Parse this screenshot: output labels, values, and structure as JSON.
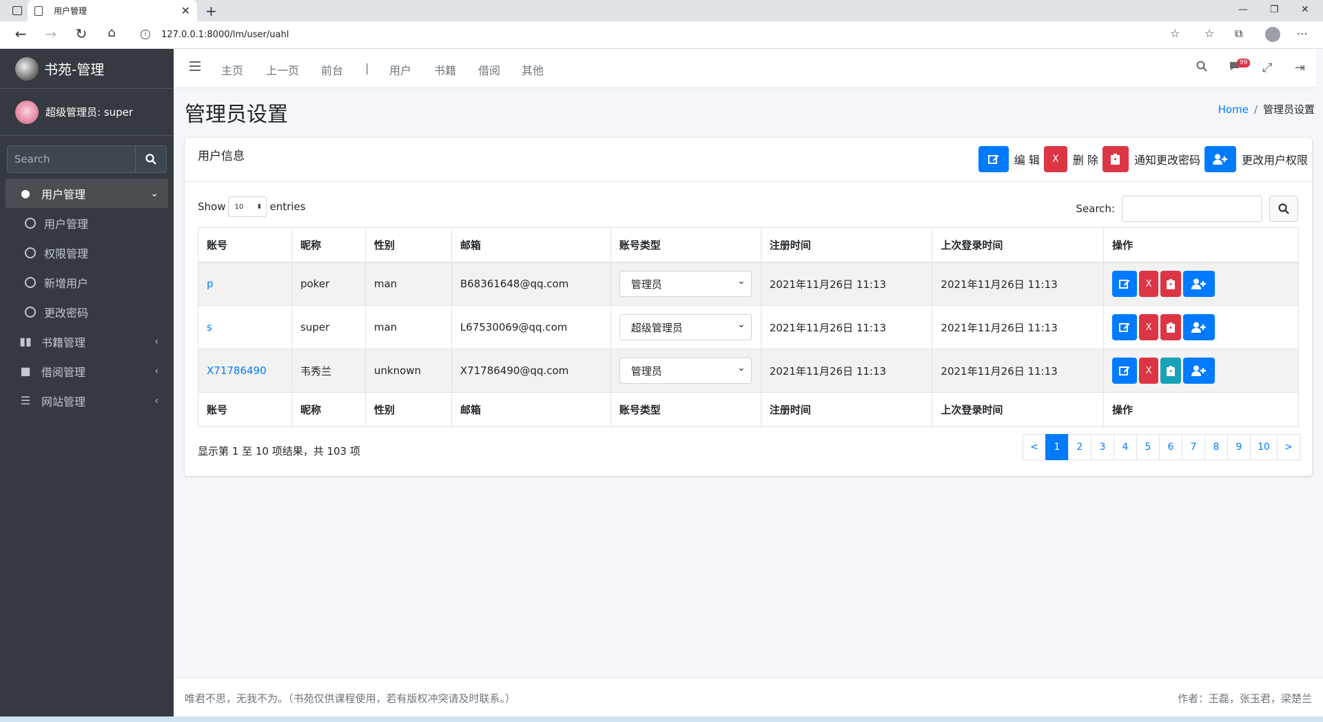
{
  "browser": {
    "tab_title": "用户管理",
    "tab_close": "✕",
    "new_tab": "+",
    "url": "127.0.0.1:8000/lm/user/uahl",
    "controls": {
      "minimize": "—",
      "restore": "❐",
      "close": "✕"
    }
  },
  "sidebar": {
    "brand": "书苑-管理",
    "user": "超级管理员: super",
    "search_placeholder": "Search",
    "items": [
      {
        "label": "用户管理",
        "icon": "user-icon",
        "active": true
      },
      {
        "label": "用户管理",
        "sub": true
      },
      {
        "label": "权限管理",
        "sub": true
      },
      {
        "label": "新增用户",
        "sub": true
      },
      {
        "label": "更改密码",
        "sub": true
      },
      {
        "label": "书籍管理",
        "icon": "book-icon"
      },
      {
        "label": "借阅管理",
        "icon": "box-icon"
      },
      {
        "label": "网站管理",
        "icon": "list-icon"
      }
    ]
  },
  "topnav": {
    "links": [
      "主页",
      "上一页",
      "前台",
      "|",
      "用户",
      "书籍",
      "借阅",
      "其他"
    ],
    "badge": "99"
  },
  "page": {
    "title": "管理员设置",
    "breadcrumb": {
      "home": "Home",
      "sep": "/",
      "current": "管理员设置"
    }
  },
  "card": {
    "title": "用户信息",
    "actions": [
      {
        "label": "编 辑",
        "color": "#007bff",
        "icon": "edit-icon"
      },
      {
        "label": "删 除",
        "color": "#dc3545",
        "icon": "x-icon",
        "text": "X"
      },
      {
        "label": "通知更改密码",
        "color": "#dc3545",
        "icon": "clipboard-icon"
      },
      {
        "label": "更改用户权限",
        "color": "#007bff",
        "icon": "user-plus-icon"
      }
    ],
    "show_label": "Show",
    "show_value": "10",
    "entries_label": "entries",
    "search_label": "Search:",
    "columns": [
      "账号",
      "昵称",
      "性别",
      "邮箱",
      "账号类型",
      "注册时间",
      "上次登录时间",
      "操作"
    ],
    "rows": [
      {
        "account": "p",
        "nickname": "poker",
        "gender": "man",
        "email": "B68361648@qq.com",
        "type": "管理员",
        "reg": "2021年11月26日 11:13",
        "last": "2021年11月26日 11:13",
        "notify_color": "#dc3545"
      },
      {
        "account": "s",
        "nickname": "super",
        "gender": "man",
        "email": "L67530069@qq.com",
        "type": "超级管理员",
        "reg": "2021年11月26日 11:13",
        "last": "2021年11月26日 11:13",
        "notify_color": "#dc3545"
      },
      {
        "account": "X71786490",
        "nickname": "韦秀兰",
        "gender": "unknown",
        "email": "X71786490@qq.com",
        "type": "管理员",
        "reg": "2021年11月26日 11:13",
        "last": "2021年11月26日 11:13",
        "notify_color": "#17a2b8"
      }
    ],
    "x_text": "X",
    "info": "显示第 1 至 10 项结果，共 103 项",
    "pager": [
      "<",
      "1",
      "2",
      "3",
      "4",
      "5",
      "6",
      "7",
      "8",
      "9",
      "10",
      ">"
    ],
    "pager_active": "1"
  },
  "footer": {
    "left": "唯君不思，无我不为。（书苑仅供课程使用，若有版权冲突请及时联系。）",
    "right": "作者：王磊，张玉君，梁楚兰"
  }
}
